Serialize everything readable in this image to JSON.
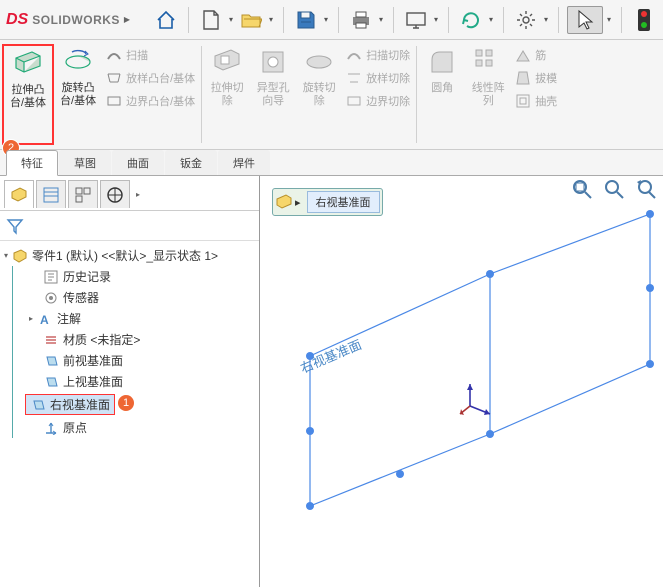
{
  "app": {
    "name": "SOLIDWORKS",
    "logo_mark": "DS"
  },
  "topbar": {
    "home": "home",
    "new": "new",
    "open": "open",
    "save": "save",
    "print": "print",
    "screen": "screen",
    "rebuild": "rebuild",
    "options": "options",
    "select": "select"
  },
  "ribbon": {
    "extrude_boss": "拉伸凸\n台/基体",
    "revolve_boss": "旋转凸\n台/基体",
    "sweep": "扫描",
    "loft_boss": "放样凸台/基体",
    "boundary_boss": "边界凸台/基体",
    "extrude_cut": "拉伸切\n除",
    "hole_wizard": "异型孔\n向导",
    "revolve_cut": "旋转切\n除",
    "sweep_cut": "扫描切除",
    "loft_cut": "放样切除",
    "boundary_cut": "边界切除",
    "fillet": "圆角",
    "linear_pattern": "线性阵\n列",
    "rib": "筋",
    "draft": "拔模",
    "shell": "抽壳"
  },
  "tabs": {
    "features": "特征",
    "sketch": "草图",
    "surfaces": "曲面",
    "sheetmetal": "钣金",
    "weldments": "焊件"
  },
  "tree": {
    "root": "零件1 (默认) <<默认>_显示状态 1>",
    "history": "历史记录",
    "sensors": "传感器",
    "annotations": "注解",
    "material": "材质 <未指定>",
    "front_plane": "前视基准面",
    "top_plane": "上视基准面",
    "right_plane": "右视基准面",
    "origin": "原点"
  },
  "viewport": {
    "breadcrumb_plane": "右视基准面",
    "plane_label": "右视基准面"
  },
  "callouts": {
    "one": "1",
    "two": "2"
  }
}
